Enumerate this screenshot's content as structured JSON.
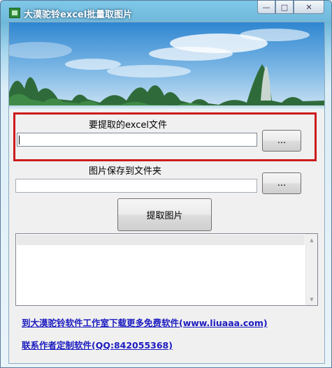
{
  "window": {
    "title": "大漠驼铃excel批量取图片",
    "min_glyph": "—",
    "max_glyph": "□",
    "close_glyph": "✕"
  },
  "excel_section": {
    "label": "要提取的excel文件",
    "input_value": "",
    "browse_label": "..."
  },
  "folder_section": {
    "label": "图片保存到文件夹",
    "input_value": "",
    "browse_label": "..."
  },
  "extract_button": "提取图片",
  "log_list": {
    "items": [
      ""
    ]
  },
  "links": {
    "download": "到大漠驼铃软件工作室下载更多免费软件(www.liuaaa.com)",
    "contact": "联系作者定制软件(QQ:842055368)"
  },
  "colors": {
    "highlight_border": "#cc1b1b",
    "link": "#1b1bc0"
  },
  "icons": {
    "scroll_up": "▲",
    "scroll_down": "▼"
  }
}
